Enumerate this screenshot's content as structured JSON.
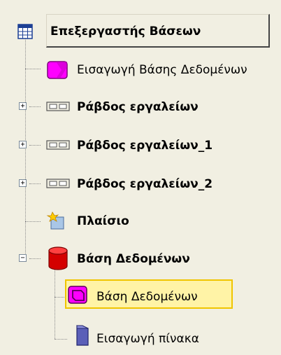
{
  "tree": {
    "root": {
      "label": "Επεξεργαστής Βάσεων",
      "icon": "grid-window-icon"
    },
    "items": [
      {
        "label": "Εισαγωγή Βάσης Δεδομένων",
        "icon": "magenta-import-icon",
        "bold": false
      },
      {
        "label": "Ράβδος εργαλείων",
        "icon": "toolbar-icon",
        "bold": true,
        "expander": "+"
      },
      {
        "label": "Ράβδος εργαλείων_1",
        "icon": "toolbar-icon",
        "bold": true,
        "expander": "+"
      },
      {
        "label": "Ράβδος εργαλείων_2",
        "icon": "toolbar-icon",
        "bold": true,
        "expander": "+"
      },
      {
        "label": "Πλαίσιο",
        "icon": "frame-icon",
        "bold": true
      },
      {
        "label": "Βάση Δεδομένων",
        "icon": "database-cylinder-icon",
        "bold": true,
        "expander": "−"
      }
    ],
    "children": [
      {
        "label": "Βάση Δεδομένων",
        "icon": "magenta-database-icon",
        "selected": true
      },
      {
        "label": "Εισαγωγή πίνακα",
        "icon": "table-import-icon",
        "selected": false
      }
    ]
  },
  "colors": {
    "background": "#f1efe2",
    "selection_fill": "#fff3a6",
    "selection_border": "#f0c500",
    "magenta": "#ff00ff",
    "database_red": "#d40000",
    "table_blue": "#5b5fb8"
  }
}
